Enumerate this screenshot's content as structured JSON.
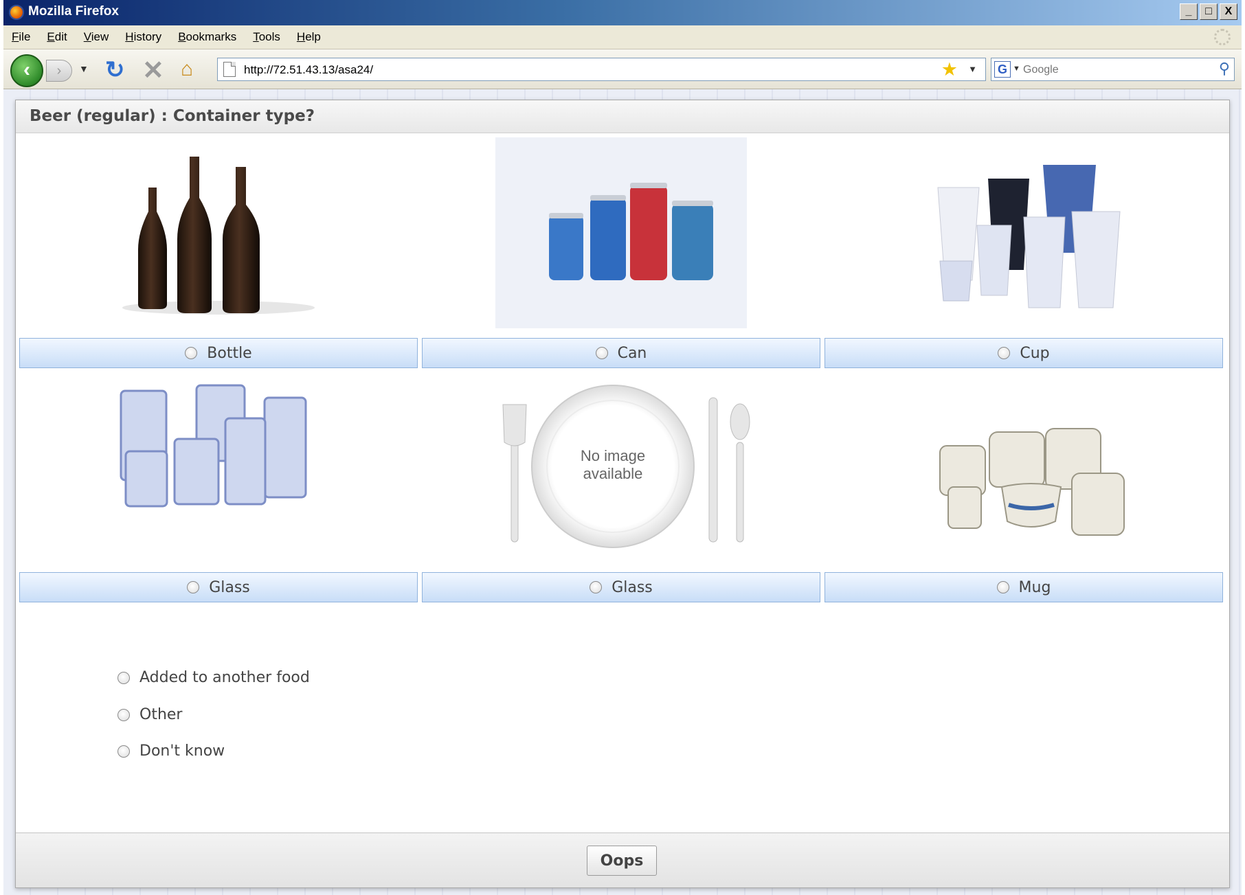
{
  "window": {
    "title": "Mozilla Firefox",
    "controls": [
      "_",
      "□",
      "X"
    ]
  },
  "menu": [
    "File",
    "Edit",
    "View",
    "History",
    "Bookmarks",
    "Tools",
    "Help"
  ],
  "navigation": {
    "url": "http://72.51.43.13/asa24/",
    "search_engine_letter": "G",
    "search_placeholder": "Google"
  },
  "question": "Beer (regular) : Container type?",
  "options": [
    {
      "label": "Bottle",
      "image": "brown-bottles-photo"
    },
    {
      "label": "Can",
      "image": "beverage-cans-photo"
    },
    {
      "label": "Cup",
      "image": "disposable-cups-photo"
    },
    {
      "label": "Glass",
      "image": "drinking-glasses-photo"
    },
    {
      "label": "Glass",
      "image": "no-image-placeholder",
      "placeholder_text": [
        "No image",
        "available"
      ]
    },
    {
      "label": "Mug",
      "image": "coffee-mugs-photo"
    }
  ],
  "extra_options": [
    "Added to another food",
    "Other",
    "Don't know"
  ],
  "footer": {
    "oops_label": "Oops"
  }
}
